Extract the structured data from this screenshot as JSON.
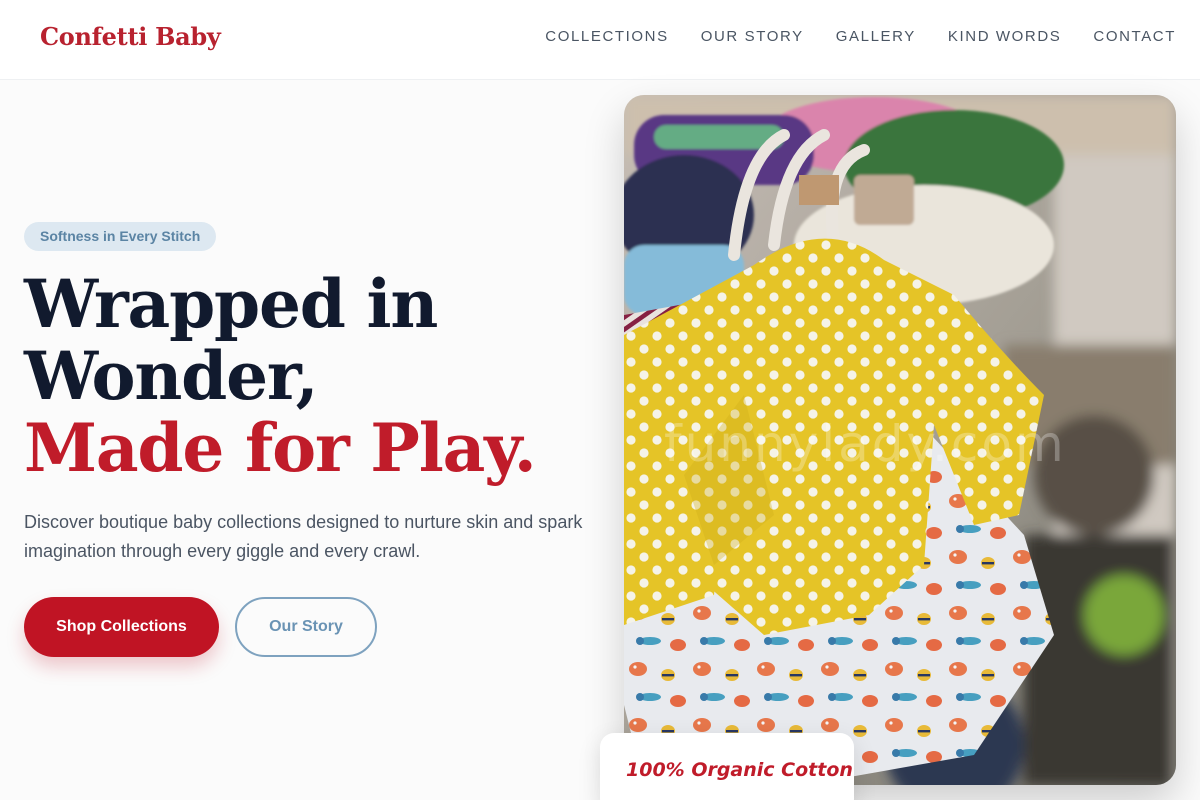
{
  "brand": {
    "name": "Confetti Baby"
  },
  "nav": {
    "items": [
      {
        "label": "COLLECTIONS"
      },
      {
        "label": "OUR STORY"
      },
      {
        "label": "GALLERY"
      },
      {
        "label": "KIND WORDS"
      },
      {
        "label": "CONTACT"
      }
    ]
  },
  "hero": {
    "eyebrow": "Softness in Every Stitch",
    "headline_line1": "Wrapped in",
    "headline_line2": "Wonder,",
    "headline_line3": "Made for Play.",
    "description": "Discover boutique baby collections designed to nurture skin and spark imagination through every giggle and every crawl.",
    "primary_cta": "Shop Collections",
    "secondary_cta": "Our Story",
    "image_watermark": "funnylady.com",
    "badge": "100% Organic Cotton"
  },
  "colors": {
    "brand_red": "#c01424",
    "headline_navy": "#111a2e",
    "accent_blue": "#7ea2bf",
    "pill_bg": "#dde8f1"
  }
}
